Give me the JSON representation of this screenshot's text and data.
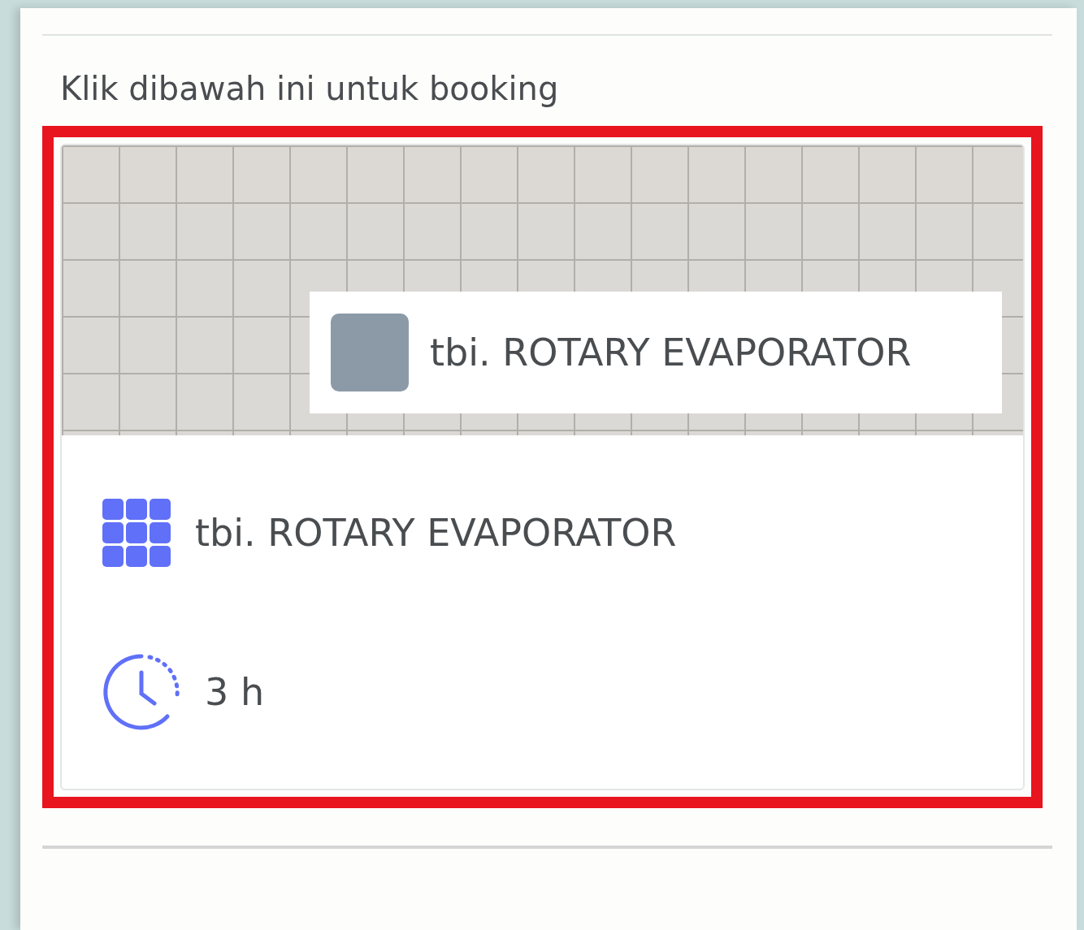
{
  "heading": "Klik dibawah ini untuk booking",
  "card": {
    "highlighted": true,
    "overlay_title": "tbi. ROTARY EVAPORATOR",
    "title": "tbi. ROTARY EVAPORATOR",
    "duration": "3 h"
  }
}
